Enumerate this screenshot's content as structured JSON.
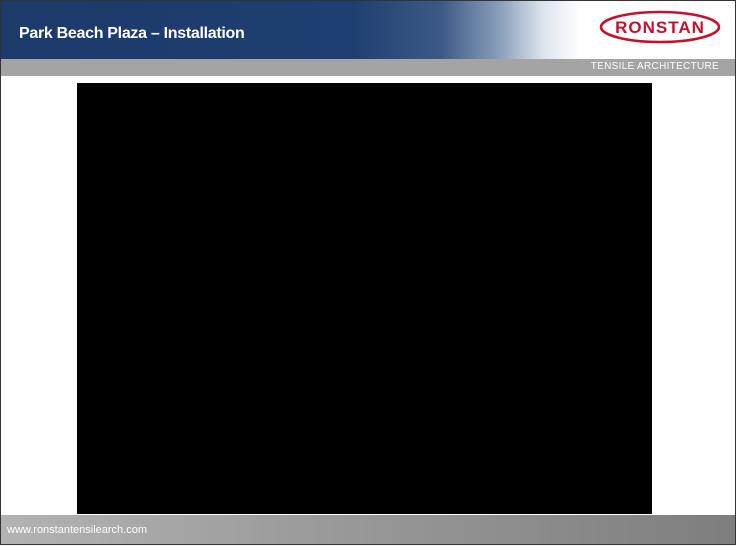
{
  "header": {
    "title": "Park Beach Plaza – Installation",
    "brand_color": "#1f3f72"
  },
  "logo": {
    "text": "RONSTAN",
    "color": "#c8102e"
  },
  "subbar": {
    "tagline": "TENSILE ARCHITECTURE"
  },
  "media": {
    "type": "video-frame"
  },
  "footer": {
    "url": "www.ronstantensilearch.com"
  }
}
